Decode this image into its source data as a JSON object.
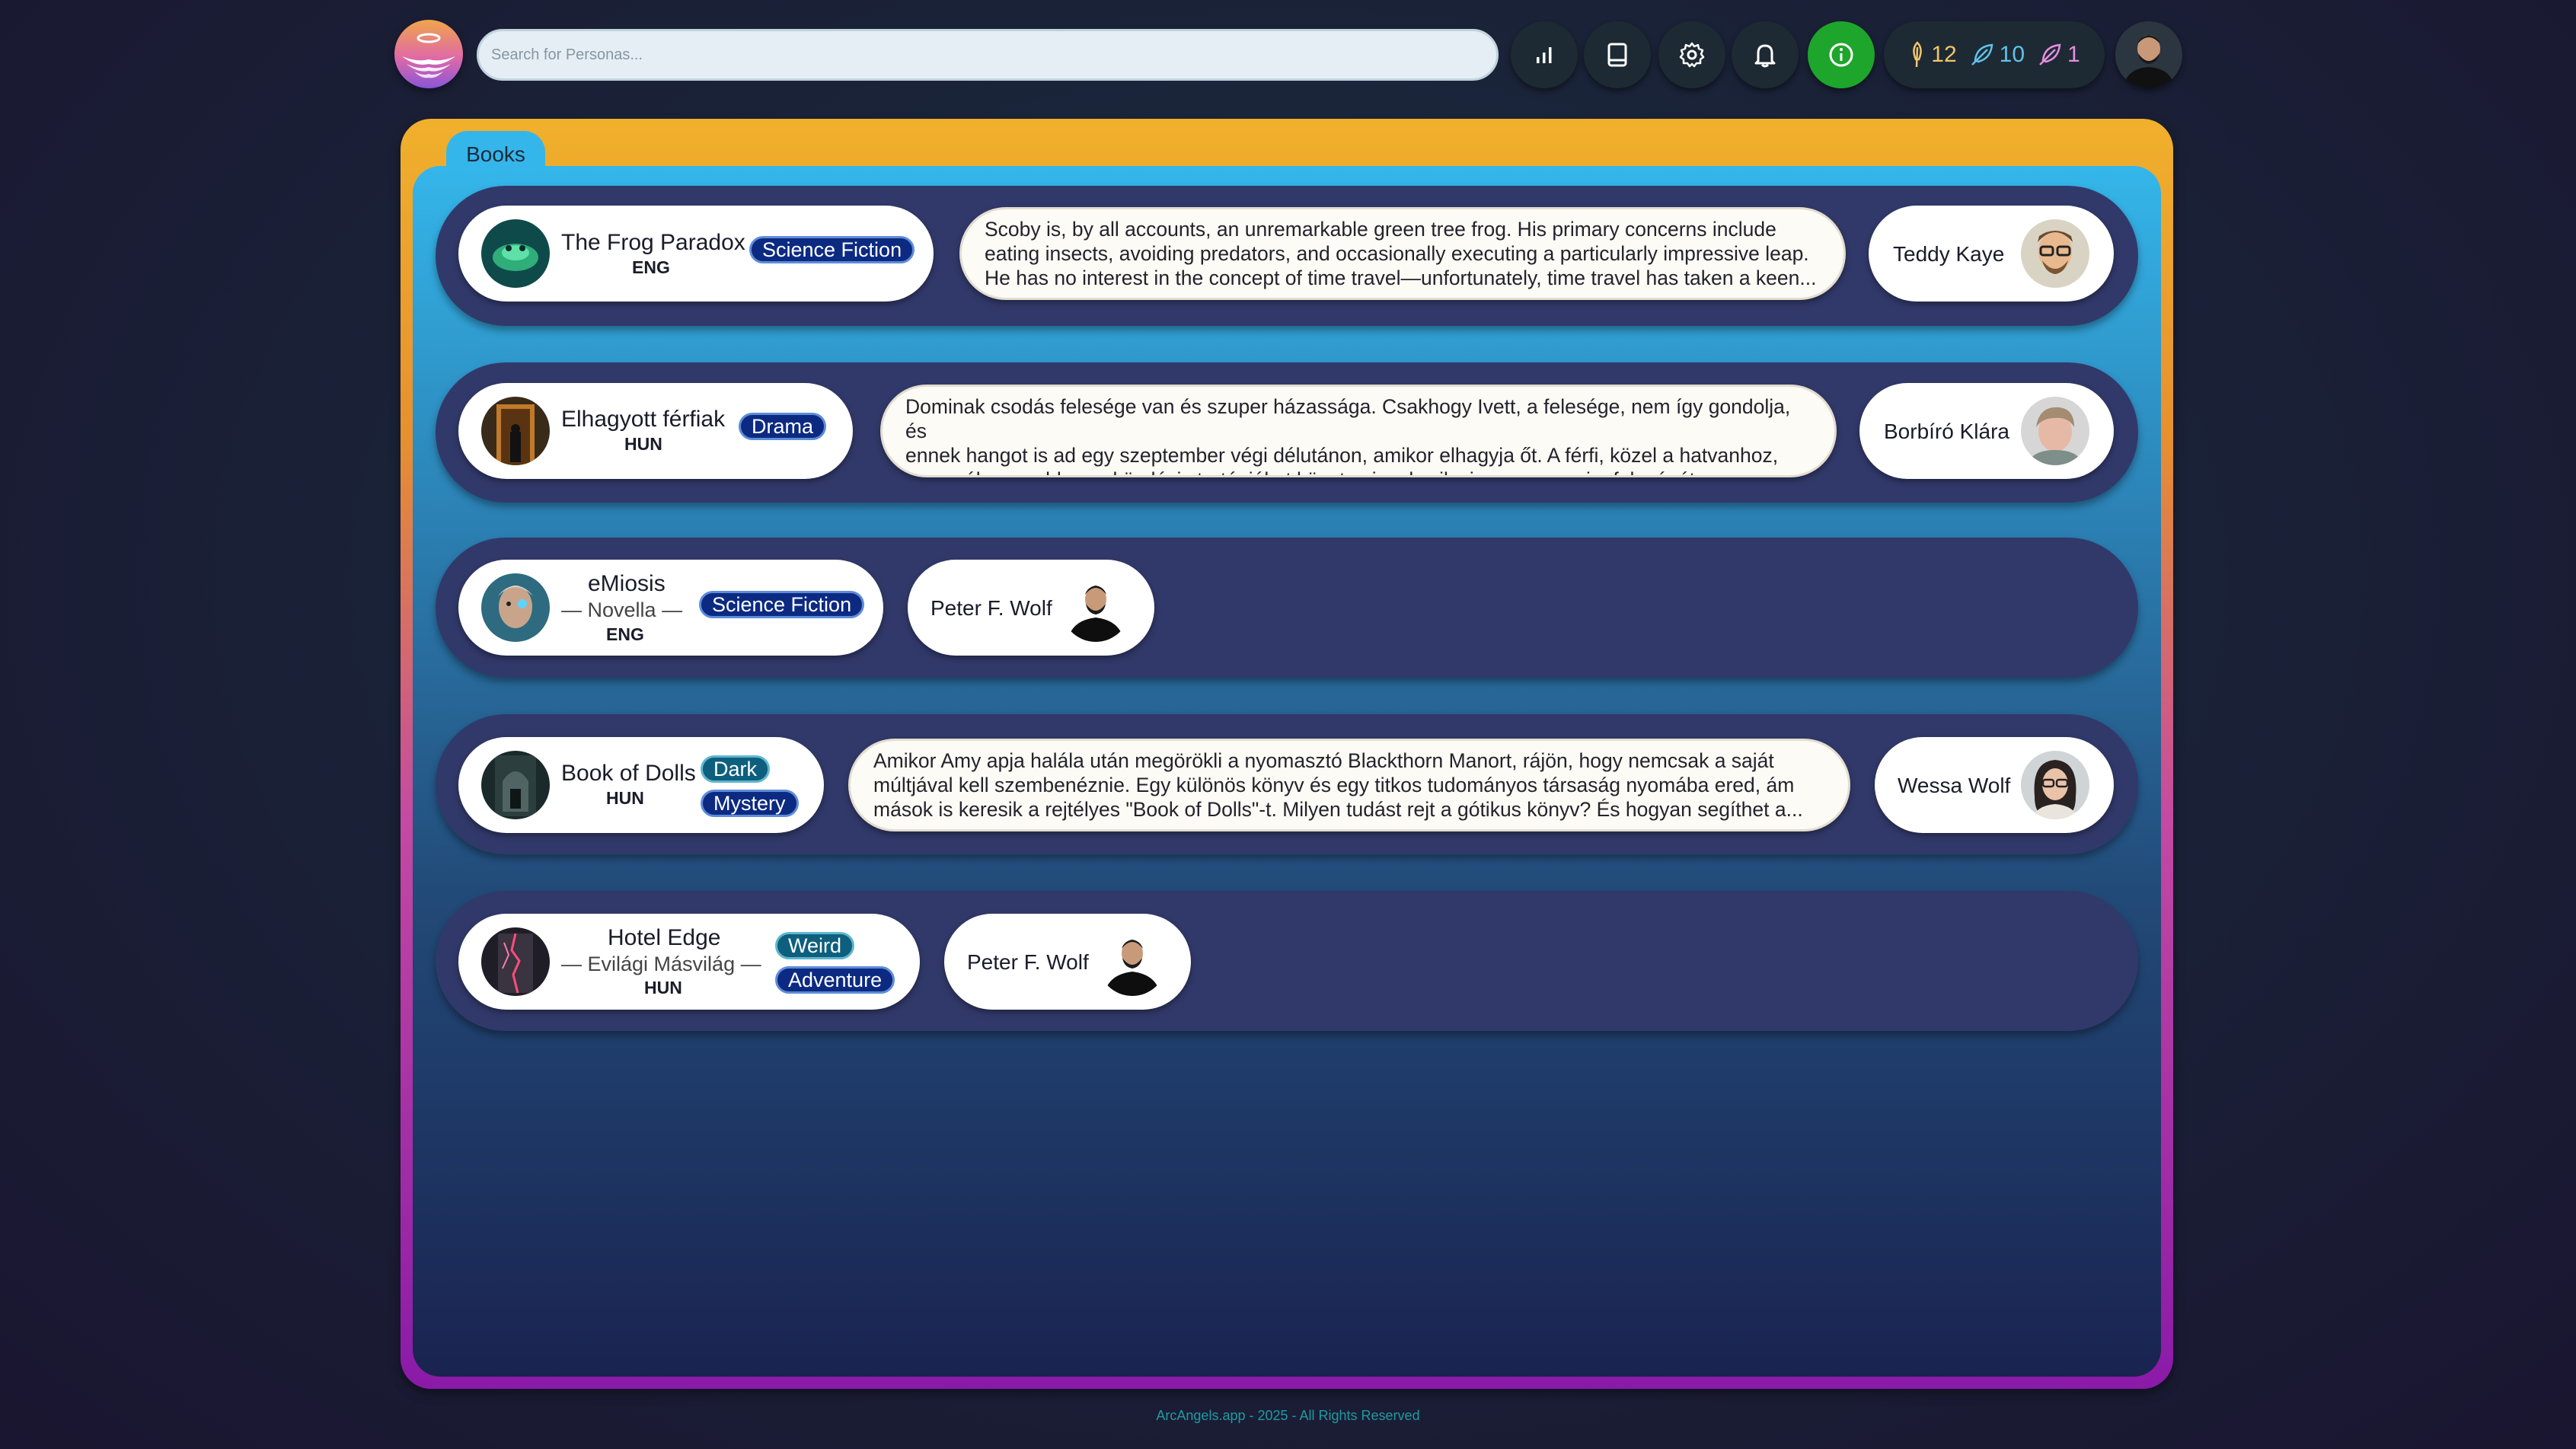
{
  "search": {
    "placeholder": "Search for Personas..."
  },
  "toolbar": {
    "buttons": [
      "chart-icon",
      "book-icon",
      "gear-icon",
      "bell-icon",
      "info-icon"
    ],
    "counters": [
      {
        "icon": "feather-gold-icon",
        "value": "12",
        "color": "#f2c56b"
      },
      {
        "icon": "feather-blue-icon",
        "value": "10",
        "color": "#5fc2ec"
      },
      {
        "icon": "feather-pink-icon",
        "value": "1",
        "color": "#e58ee0"
      }
    ]
  },
  "tab": {
    "label": "Books"
  },
  "books": [
    {
      "title": "The Frog Paradox",
      "subtitle": "",
      "lang": "ENG",
      "tags": [
        "Science Fiction"
      ],
      "description": [
        "Scoby is, by all accounts, an unremarkable green tree frog. His primary concerns include",
        "eating insects, avoiding predators, and occasionally executing a particularly impressive leap.",
        "He has no interest in the concept of time travel—unfortunately, time travel has taken a keen..."
      ],
      "author": "Teddy Kaye"
    },
    {
      "title": "Elhagyott férfiak",
      "subtitle": "",
      "lang": "HUN",
      "tags": [
        "Drama"
      ],
      "description": [
        "Dominak csodás felesége van és szuper házassága. Csakhogy Ivett, a felesége, nem így gondolja, és",
        "ennek hangot is ad egy szeptember végi délutánon, amikor elhagyja őt. A férfi, közel a hatvanhoz,",
        "rossznál rosszabb megküzdési stratégiákat követve igyekszik visszaszerezni a feleségét, a..."
      ],
      "author": "Borbíró Klára"
    },
    {
      "title": "eMiosis",
      "subtitle": "Novella",
      "lang": "ENG",
      "tags": [
        "Science Fiction"
      ],
      "description": [],
      "author": "Peter F. Wolf"
    },
    {
      "title": "Book of Dolls",
      "subtitle": "",
      "lang": "HUN",
      "tags": [
        "Dark",
        "Mystery"
      ],
      "description": [
        "Amikor Amy apja halála után megörökli a nyomasztó Blackthorn Manort, rájön, hogy nemcsak a saját",
        "múltjával kell szembenéznie. Egy különös könyv és egy titkos tudományos társaság nyomába ered, ám",
        "mások is keresik a rejtélyes \"Book of Dolls\"-t. Milyen tudást rejt a gótikus könyv? És hogyan segíthet a..."
      ],
      "author": "Wessa Wolf"
    },
    {
      "title": "Hotel Edge",
      "subtitle": "Evilági Másvilág",
      "lang": "HUN",
      "tags": [
        "Weird",
        "Adventure"
      ],
      "description": [],
      "author": "Peter F. Wolf"
    }
  ],
  "footer": {
    "text": "ArcAngels.app - 2025 - All Rights Reserved"
  }
}
